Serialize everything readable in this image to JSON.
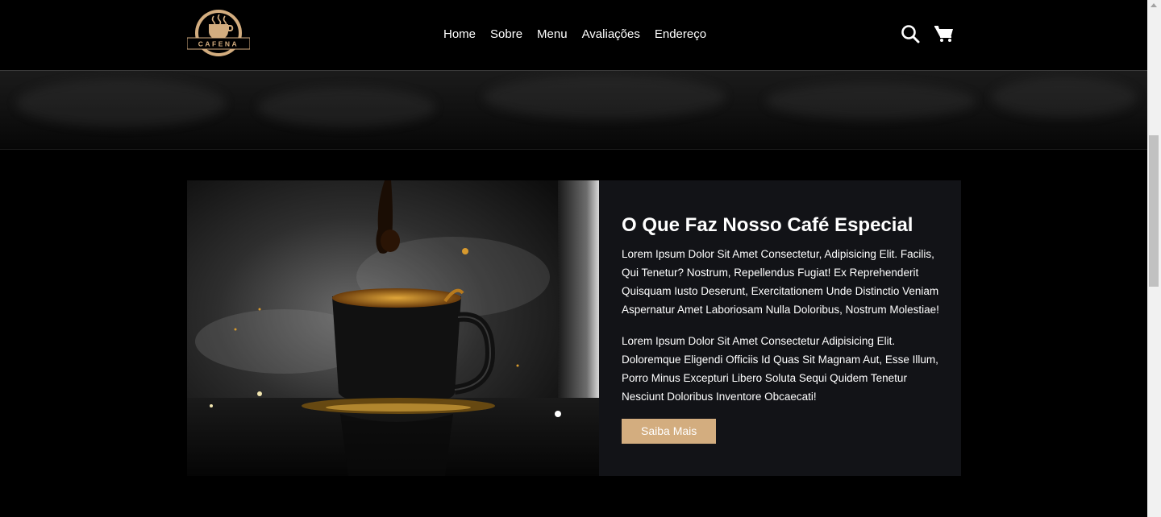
{
  "header": {
    "logo_text": "CAFENA",
    "nav": [
      "Home",
      "Sobre",
      "Menu",
      "Avaliações",
      "Endereço"
    ],
    "icons": [
      "search-icon",
      "cart-icon"
    ]
  },
  "about": {
    "title": "O Que Faz Nosso Café Especial",
    "paragraph1": "Lorem Ipsum Dolor Sit Amet Consectetur, Adipisicing Elit. Facilis, Qui Tenetur? Nostrum, Repellendus Fugiat! Ex Reprehenderit Quisquam Iusto Deserunt, Exercitationem Unde Distinctio Veniam Aspernatur Amet Laboriosam Nulla Doloribus, Nostrum Molestiae!",
    "paragraph2": "Lorem Ipsum Dolor Sit Amet Consectetur Adipisicing Elit. Doloremque Eligendi Officiis Id Quas Sit Magnam Aut, Esse Illum, Porro Minus Excepturi Libero Soluta Sequi Quidem Tenetur Nesciunt Doloribus Inventore Obcaecati!",
    "button": "Saiba Mais"
  },
  "colors": {
    "accent": "#d3ad7f",
    "background": "#000000",
    "card": "#121317"
  }
}
